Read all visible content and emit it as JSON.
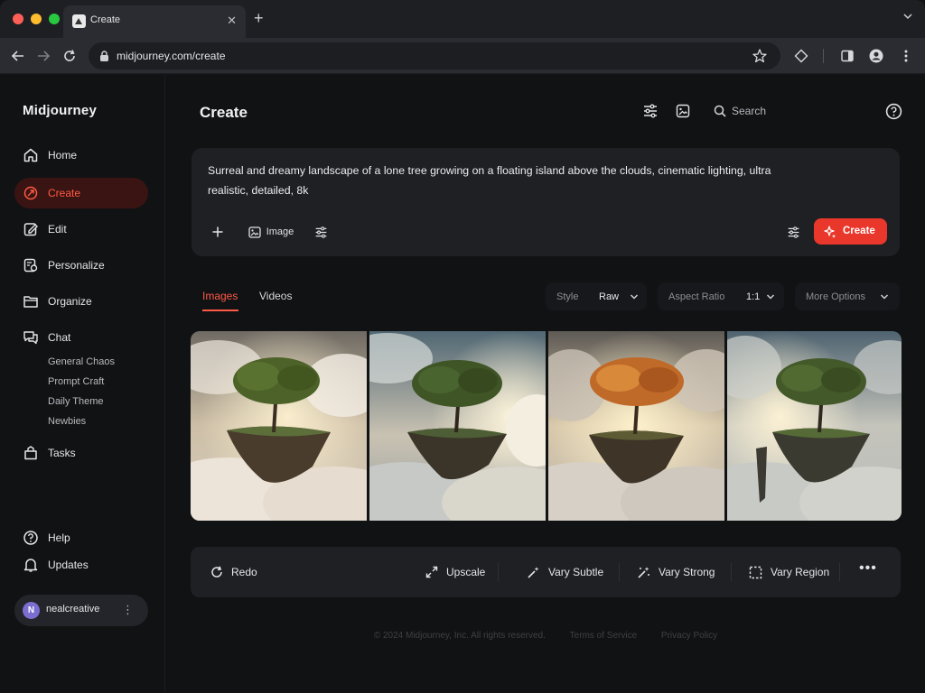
{
  "browser": {
    "tab_title": "Create",
    "url": "midjourney.com/create",
    "lights": [
      "#ff5f57",
      "#febc2e",
      "#28c840"
    ]
  },
  "sidebar": {
    "brand": "Midjourney",
    "items": [
      {
        "label": "Home",
        "icon": "home-icon"
      },
      {
        "label": "Create",
        "icon": "create-icon",
        "active": true
      },
      {
        "label": "Edit",
        "icon": "edit-icon"
      },
      {
        "label": "Personalize",
        "icon": "personalize-icon"
      },
      {
        "label": "Organize",
        "icon": "folder-icon"
      },
      {
        "label": "Chat",
        "icon": "chat-icon"
      }
    ],
    "chat_channels": [
      "General Chaos",
      "Prompt Craft",
      "Daily Theme",
      "Newbies"
    ],
    "tasks_label": "Tasks",
    "help_label": "Help",
    "updates_label": "Updates",
    "user": {
      "initial": "N",
      "name": "nealcreative"
    }
  },
  "header": {
    "title": "Create",
    "search_placeholder": "Search"
  },
  "prompt": {
    "text": "Surreal and dreamy landscape of a lone tree growing on a floating island above the clouds, cinematic lighting, ultra realistic, detailed, 8k",
    "image_label": "Image",
    "create_label": "Create"
  },
  "media_tabs": {
    "images": "Images",
    "videos": "Videos"
  },
  "options": {
    "style_label": "Style",
    "style_value": "Raw",
    "aspect_label": "Aspect Ratio",
    "aspect_value": "1:1",
    "more_label": "More Options"
  },
  "actions": {
    "redo": "Redo",
    "upscale": "Upscale",
    "vary_subtle": "Vary Subtle",
    "vary_strong": "Vary Strong",
    "vary_region": "Vary Region"
  },
  "footer": {
    "copyright": "© 2024 Midjourney, Inc. All rights reserved.",
    "terms": "Terms of Service",
    "privacy": "Privacy Policy"
  },
  "colors": {
    "accent": "#e9382b",
    "accent_text": "#ff5a45",
    "background": "#111214",
    "card": "#1f2024"
  }
}
